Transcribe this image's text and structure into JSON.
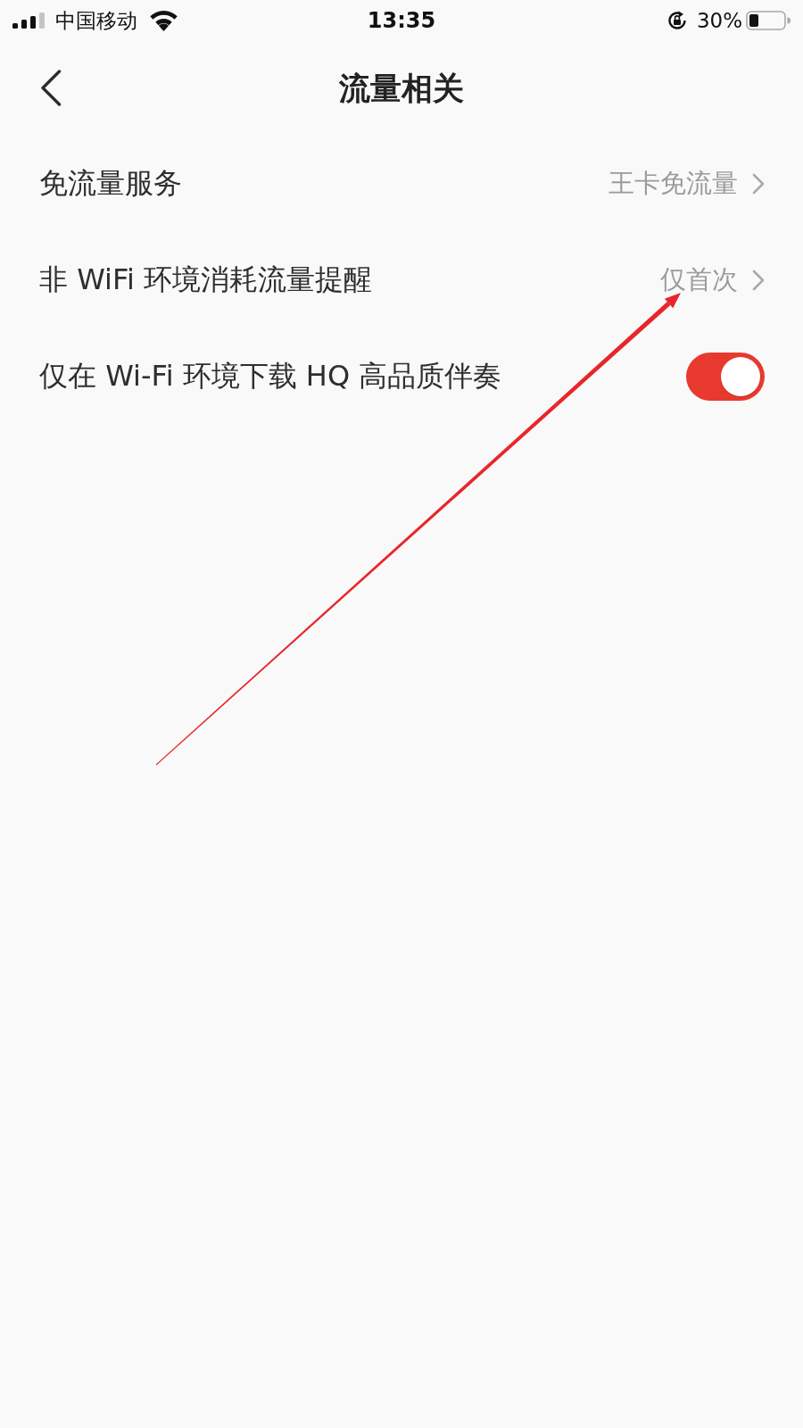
{
  "status_bar": {
    "carrier": "中国移动",
    "time": "13:35",
    "battery": "30%"
  },
  "header": {
    "title": "流量相关"
  },
  "settings": [
    {
      "kind": "link",
      "label": "免流量服务",
      "value": "王卡免流量"
    },
    {
      "kind": "link",
      "label": "非 WiFi 环境消耗流量提醒",
      "value": "仅首次"
    },
    {
      "kind": "toggle",
      "label": "仅在 Wi-Fi 环境下载 HQ 高品质伴奏",
      "on": true
    }
  ]
}
